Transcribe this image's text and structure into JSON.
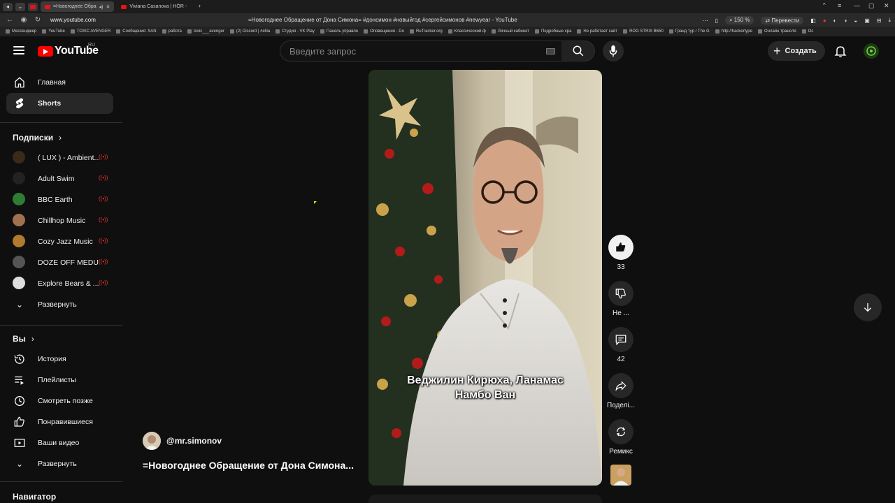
{
  "browser": {
    "tabs": [
      {
        "label": "=Новогоднее Обра",
        "active": true
      },
      {
        "label": "Viviana Casanova | HÖR -",
        "active": false
      }
    ],
    "window_controls": [
      "⌃",
      "—",
      "▢",
      "✕"
    ],
    "url": "www.youtube.com",
    "page_title": "=Новогоднее Обращение от Дона Симона= #донсимон #новыйгод #сергейсимонов #newyear - YouTube",
    "zoom": "150 %",
    "translate_label": "Перевести",
    "bookmarks": [
      "Мессенджер",
      "YouTube",
      "TOXIC AVENGER",
      "Сообщения: SAN",
      "работа",
      "toxic___avenger",
      "(2) Discord | #ellia",
      "Студия - VK Play",
      "Панель управле",
      "Оповещения - Do",
      "RuTracker.org",
      "Классический ф",
      "Личный кабинет",
      "Подробные сра",
      "Не работает сайт",
      "ROG STRIX B650",
      "Гранд тур / The G",
      "http://hackertype",
      "Онлайн трансля",
      "Ос"
    ]
  },
  "header": {
    "logo_text": "YouTube",
    "logo_region": "RU",
    "search_placeholder": "Введите запрос",
    "create_label": "Создать"
  },
  "sidebar": {
    "main": [
      {
        "label": "Главная",
        "icon": "home-icon"
      },
      {
        "label": "Shorts",
        "icon": "shorts-icon",
        "active": true
      }
    ],
    "subscriptions_title": "Подписки",
    "subscriptions": [
      {
        "label": "( LUX ) - Ambient...",
        "color": "#3a2a1a"
      },
      {
        "label": "Adult Swim",
        "color": "#222222"
      },
      {
        "label": "BBC Earth",
        "color": "#2e7d32"
      },
      {
        "label": "Chillhop Music",
        "color": "#a07050"
      },
      {
        "label": "Cozy Jazz Music",
        "color": "#b07a30"
      },
      {
        "label": "DOZE OFF MEDU...",
        "color": "#555555"
      },
      {
        "label": "Explore Bears & ...",
        "color": "#dddddd"
      }
    ],
    "expand_label": "Развернуть",
    "you_title": "Вы",
    "you": [
      {
        "label": "История",
        "icon": "history-icon"
      },
      {
        "label": "Плейлисты",
        "icon": "playlists-icon"
      },
      {
        "label": "Смотреть позже",
        "icon": "watch-later-icon"
      },
      {
        "label": "Понравившиеся",
        "icon": "liked-icon"
      },
      {
        "label": "Ваши видео",
        "icon": "your-videos-icon"
      }
    ],
    "expand_label_2": "Развернуть",
    "navigator_title": "Навигатор"
  },
  "short": {
    "subtitle_line1": "Веджилин Кирюха, Ланамас",
    "subtitle_line2": "Намбо Ван",
    "channel": "@mr.simonov",
    "title": "=Новогоднее Обращение от Дона Симона..."
  },
  "actions": {
    "likes": "33",
    "dislike_label": "Не ...",
    "comments": "42",
    "share_label": "Поделі...",
    "remix_label": "Ремикс"
  }
}
